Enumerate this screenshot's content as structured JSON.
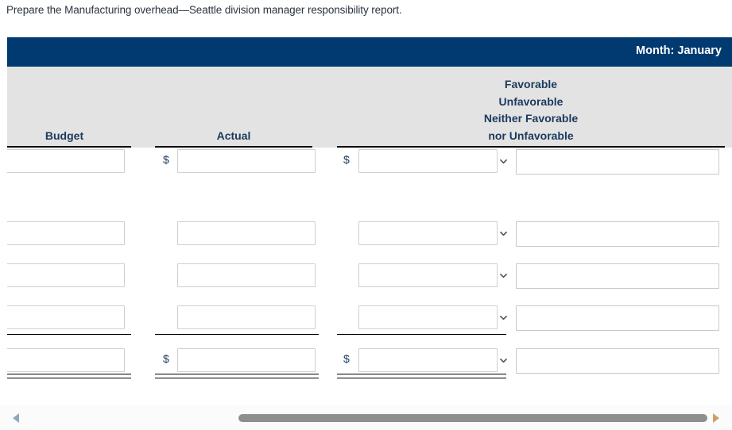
{
  "instruction": "Prepare the Manufacturing overhead—Seattle division manager responsibility report.",
  "titlebar": {
    "month_label": "Month: January"
  },
  "columns": {
    "budget": "Budget",
    "actual": "Actual",
    "variance_line1": "Favorable",
    "variance_line2": "Unfavorable",
    "variance_line3": "Neither Favorable",
    "variance_line4": "nor Unfavorable"
  },
  "symbols": {
    "dollar": "$",
    "chevron_down": "chevron-down-icon"
  },
  "rows": [
    {
      "id": "row-1",
      "show_dollar_actual": true,
      "show_dollar_variance": true,
      "budget_value": "",
      "actual_value": "",
      "variance_value": "",
      "select_value": "",
      "rule": "none"
    },
    {
      "id": "row-2",
      "show_dollar_actual": false,
      "show_dollar_variance": false,
      "budget_value": "",
      "actual_value": "",
      "variance_value": "",
      "select_value": "",
      "rule": "none"
    },
    {
      "id": "row-3",
      "show_dollar_actual": false,
      "show_dollar_variance": false,
      "budget_value": "",
      "actual_value": "",
      "variance_value": "",
      "select_value": "",
      "rule": "none"
    },
    {
      "id": "row-4",
      "show_dollar_actual": false,
      "show_dollar_variance": false,
      "budget_value": "",
      "actual_value": "",
      "variance_value": "",
      "select_value": "",
      "rule": "single"
    },
    {
      "id": "row-5-total",
      "show_dollar_actual": true,
      "show_dollar_variance": true,
      "budget_value": "",
      "actual_value": "",
      "variance_value": "",
      "select_value": "",
      "rule": "double"
    }
  ],
  "select_options": [
    "",
    "Favorable",
    "Unfavorable",
    "Neither Favorable nor Unfavorable"
  ],
  "input_placeholder": "",
  "scrollbar": {
    "left_arrow": "scroll-left-icon",
    "right_arrow": "scroll-right-icon"
  },
  "colors": {
    "titlebar_navy": "#003a70",
    "header_band_gray": "#e3e3e3",
    "header_text_navy": "#1b3a5c",
    "input_border": "#cfcfcf",
    "scroll_thumb": "#8e8e8e"
  }
}
